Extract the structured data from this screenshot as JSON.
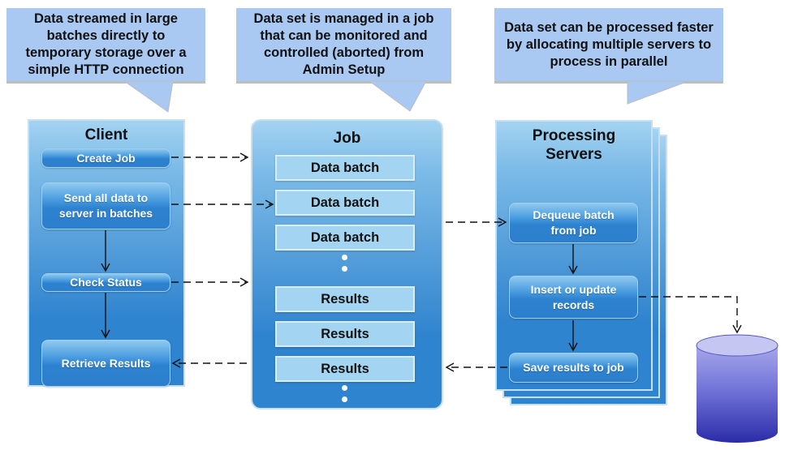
{
  "callouts": [
    {
      "text": "Data streamed in large batches directly to temporary storage over a simple HTTP connection"
    },
    {
      "text": "Data set is managed in a job that can be monitored and controlled (aborted) from Admin Setup"
    },
    {
      "text": "Data set can be processed faster by allocating multiple servers to process in parallel"
    }
  ],
  "client": {
    "title": "Client",
    "steps": [
      {
        "label": "Create Job"
      },
      {
        "label": "Send all data to server in batches"
      },
      {
        "label": "Check Status"
      },
      {
        "label": "Retrieve Results"
      }
    ]
  },
  "job": {
    "title": "Job",
    "data_batches": [
      "Data batch",
      "Data batch",
      "Data batch"
    ],
    "results": [
      "Results",
      "Results",
      "Results"
    ]
  },
  "processing": {
    "title": "Processing Servers",
    "steps": [
      {
        "label": "Dequeue batch from job"
      },
      {
        "label": "Insert or update records"
      },
      {
        "label": "Save results to job"
      }
    ]
  },
  "database": {
    "icon": "database-cylinder-icon",
    "color_top": "#c5c6f2",
    "color_bottom": "#2a2ca8"
  },
  "colors": {
    "callout": "#a9c8f2",
    "panel_top": "#a4d3f1",
    "panel_bottom": "#2f84cf",
    "slot": "#a3d5f2"
  }
}
